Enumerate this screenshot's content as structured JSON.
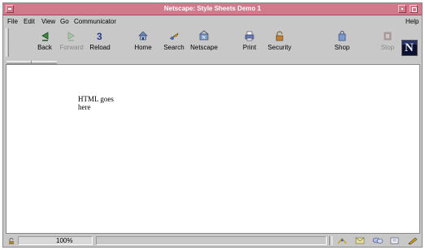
{
  "window": {
    "title": "Netscape: Style Sheets Demo 1",
    "accent_color": "#d27a8c"
  },
  "menubar": {
    "items": [
      "File",
      "Edit",
      "View",
      "Go",
      "Communicator"
    ],
    "help": "Help"
  },
  "toolbar": {
    "buttons": [
      {
        "label": "Back",
        "icon": "back-arrow-icon",
        "enabled": true
      },
      {
        "label": "Forward",
        "icon": "forward-arrow-icon",
        "enabled": false
      },
      {
        "label": "Reload",
        "icon": "reload-icon",
        "enabled": true
      },
      {
        "label": "Home",
        "icon": "home-icon",
        "enabled": true
      },
      {
        "label": "Search",
        "icon": "search-icon",
        "enabled": true
      },
      {
        "label": "Netscape",
        "icon": "netscape-icon",
        "enabled": true
      },
      {
        "label": "Print",
        "icon": "print-icon",
        "enabled": true
      },
      {
        "label": "Security",
        "icon": "security-lock-icon",
        "enabled": true
      },
      {
        "label": "Shop",
        "icon": "shop-bag-icon",
        "enabled": true
      },
      {
        "label": "Stop",
        "icon": "stop-icon",
        "enabled": false
      }
    ],
    "logo_letter": "N"
  },
  "content": {
    "text_line1": "HTML goes",
    "text_line2": "here"
  },
  "statusbar": {
    "zoom": "100%"
  }
}
